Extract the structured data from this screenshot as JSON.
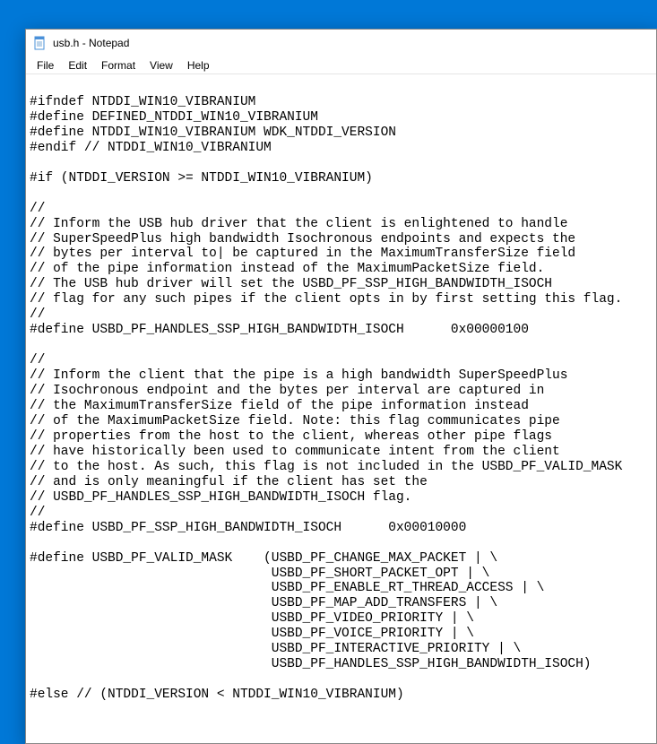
{
  "window": {
    "title": "usb.h - Notepad"
  },
  "menubar": {
    "items": [
      "File",
      "Edit",
      "Format",
      "View",
      "Help"
    ]
  },
  "editor": {
    "content": "\n#ifndef NTDDI_WIN10_VIBRANIUM\n#define DEFINED_NTDDI_WIN10_VIBRANIUM\n#define NTDDI_WIN10_VIBRANIUM WDK_NTDDI_VERSION\n#endif // NTDDI_WIN10_VIBRANIUM\n\n#if (NTDDI_VERSION >= NTDDI_WIN10_VIBRANIUM)\n\n//\n// Inform the USB hub driver that the client is enlightened to handle\n// SuperSpeedPlus high bandwidth Isochronous endpoints and expects the\n// bytes per interval to| be captured in the MaximumTransferSize field\n// of the pipe information instead of the MaximumPacketSize field.\n// The USB hub driver will set the USBD_PF_SSP_HIGH_BANDWIDTH_ISOCH\n// flag for any such pipes if the client opts in by first setting this flag.\n//\n#define USBD_PF_HANDLES_SSP_HIGH_BANDWIDTH_ISOCH      0x00000100\n\n//\n// Inform the client that the pipe is a high bandwidth SuperSpeedPlus\n// Isochronous endpoint and the bytes per interval are captured in\n// the MaximumTransferSize field of the pipe information instead\n// of the MaximumPacketSize field. Note: this flag communicates pipe\n// properties from the host to the client, whereas other pipe flags\n// have historically been used to communicate intent from the client\n// to the host. As such, this flag is not included in the USBD_PF_VALID_MASK\n// and is only meaningful if the client has set the\n// USBD_PF_HANDLES_SSP_HIGH_BANDWIDTH_ISOCH flag.\n//\n#define USBD_PF_SSP_HIGH_BANDWIDTH_ISOCH      0x00010000\n\n#define USBD_PF_VALID_MASK    (USBD_PF_CHANGE_MAX_PACKET | \\\n                               USBD_PF_SHORT_PACKET_OPT | \\\n                               USBD_PF_ENABLE_RT_THREAD_ACCESS | \\\n                               USBD_PF_MAP_ADD_TRANSFERS | \\\n                               USBD_PF_VIDEO_PRIORITY | \\\n                               USBD_PF_VOICE_PRIORITY | \\\n                               USBD_PF_INTERACTIVE_PRIORITY | \\\n                               USBD_PF_HANDLES_SSP_HIGH_BANDWIDTH_ISOCH)\n\n#else // (NTDDI_VERSION < NTDDI_WIN10_VIBRANIUM)"
  }
}
